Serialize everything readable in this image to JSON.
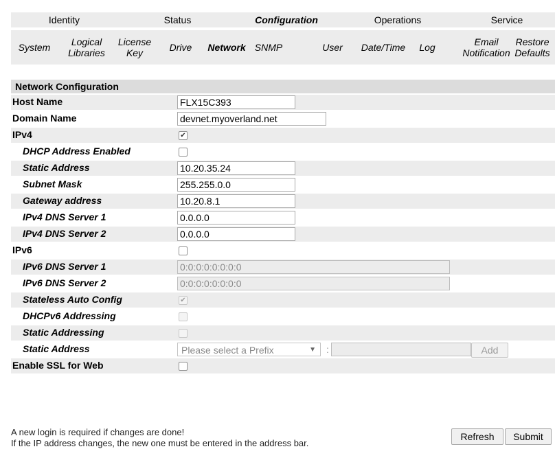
{
  "tabs": [
    {
      "label": "Identity"
    },
    {
      "label": "Status"
    },
    {
      "label": "Configuration"
    },
    {
      "label": "Operations"
    },
    {
      "label": "Service"
    }
  ],
  "subnav": [
    {
      "label": "System"
    },
    {
      "label": "Logical Libraries"
    },
    {
      "label": "License Key"
    },
    {
      "label": "Drive"
    },
    {
      "label": "Network"
    },
    {
      "label": "SNMP"
    },
    {
      "label": "User"
    },
    {
      "label": "Date/Time"
    },
    {
      "label": "Log"
    },
    {
      "label": "Email Notification"
    },
    {
      "label": "Restore Defaults"
    }
  ],
  "form": {
    "header": "Network Configuration",
    "host_name": {
      "label": "Host Name",
      "value": "FLX15C393"
    },
    "domain_name": {
      "label": "Domain Name",
      "value": "devnet.myoverland.net"
    },
    "ipv4": {
      "label": "IPv4",
      "checked": true
    },
    "dhcp": {
      "label": "DHCP Address Enabled",
      "checked": false
    },
    "static_address": {
      "label": "Static Address",
      "value": "10.20.35.24"
    },
    "subnet_mask": {
      "label": "Subnet Mask",
      "value": "255.255.0.0"
    },
    "gateway": {
      "label": "Gateway address",
      "value": "10.20.8.1"
    },
    "ipv4_dns1": {
      "label": "IPv4 DNS Server 1",
      "value": "0.0.0.0"
    },
    "ipv4_dns2": {
      "label": "IPv4 DNS Server 2",
      "value": "0.0.0.0"
    },
    "ipv6": {
      "label": "IPv6",
      "checked": false
    },
    "ipv6_dns1": {
      "label": "IPv6 DNS Server 1",
      "value": "0:0:0:0:0:0:0:0"
    },
    "ipv6_dns2": {
      "label": "IPv6 DNS Server 2",
      "value": "0:0:0:0:0:0:0:0"
    },
    "stateless": {
      "label": "Stateless Auto Config",
      "checked": true
    },
    "dhcpv6": {
      "label": "DHCPv6 Addressing",
      "checked": false
    },
    "static_addressing": {
      "label": "Static Addressing",
      "checked": false
    },
    "ipv6_static": {
      "label": "Static Address",
      "prefix_placeholder": "Please select a Prefix",
      "colon": ":",
      "add_label": "Add"
    },
    "ssl": {
      "label": "Enable SSL for Web",
      "checked": false
    }
  },
  "notes": {
    "line1": "A new login is required if changes are done!",
    "line2": "If the IP address changes, the new one must be entered in the address bar."
  },
  "buttons": {
    "refresh": "Refresh",
    "submit": "Submit"
  },
  "icons": {
    "checkmark": "✔",
    "dropdown_arrow": "▼"
  }
}
